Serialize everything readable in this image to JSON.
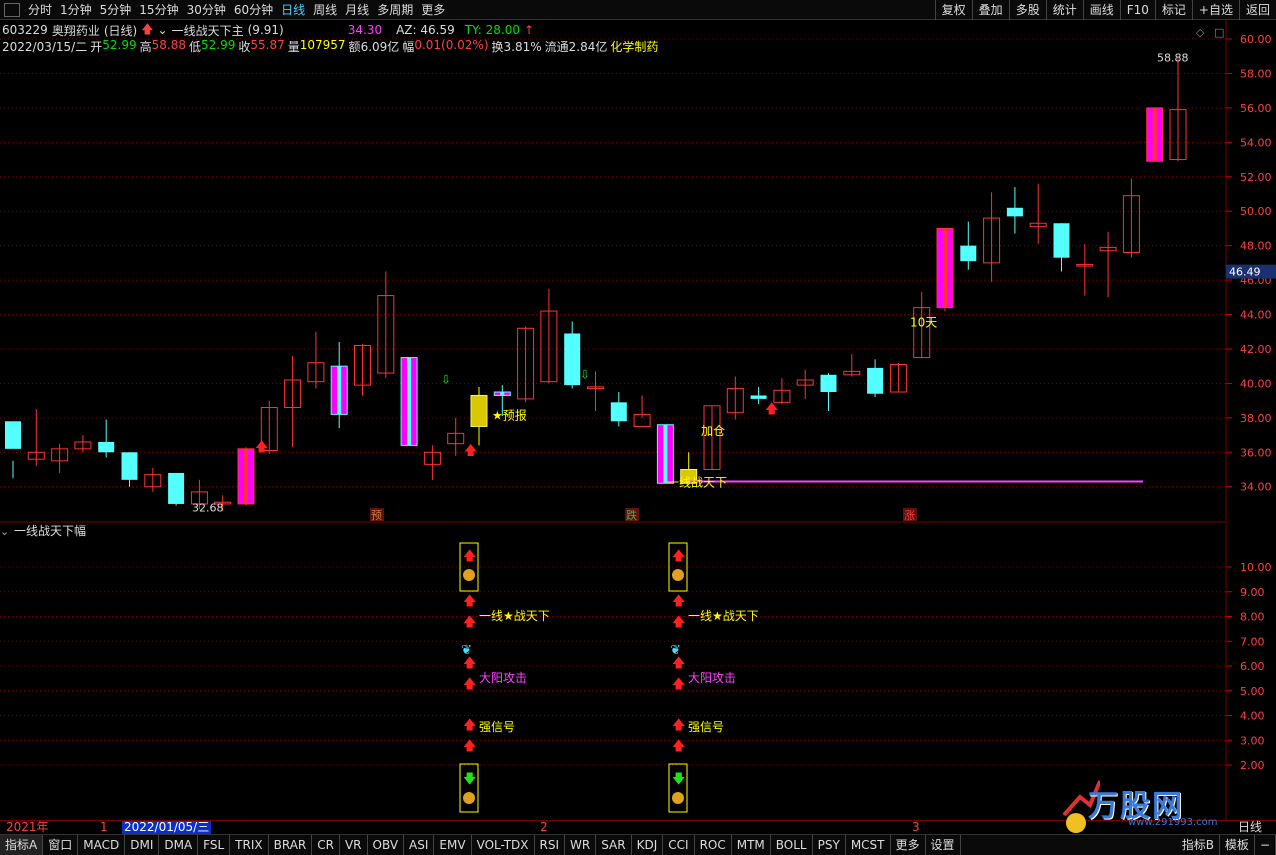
{
  "toolbar": {
    "periods": [
      "分时",
      "1分钟",
      "5分钟",
      "15分钟",
      "30分钟",
      "60分钟",
      "日线",
      "周线",
      "月线",
      "多周期",
      "更多"
    ],
    "active_period": "日线",
    "right_buttons": [
      "复权",
      "叠加",
      "多股",
      "统计",
      "画线",
      "F10",
      "标记",
      "+自选",
      "返回"
    ]
  },
  "info": {
    "code": "603229",
    "name": "奥翔药业",
    "period": "(日线)",
    "indicator": "一线战天下主",
    "indicator_param": "(9.91)",
    "val1": "34.30",
    "az": "AZ: 46.59",
    "ty": "TY: 28.00",
    "date": "2022/03/15/二",
    "open_label": "开",
    "open": "52.99",
    "high_label": "高",
    "high": "58.88",
    "low_label": "低",
    "low": "52.99",
    "close_label": "收",
    "close": "55.87",
    "vol_label": "量",
    "vol": "107957",
    "amt_label": "额",
    "amt": "6.09亿",
    "chg_label": "幅",
    "chg": "0.01(0.02%)",
    "turnover": "换3.81%",
    "float": "流通2.84亿",
    "sector": "化学制药"
  },
  "colors": {
    "up": "#ff3232",
    "down": "#54ffff",
    "special": "#ff00ff",
    "yellow": "#ffff00",
    "grid": "#7a0000"
  },
  "main_axis": {
    "labels": [
      "60.00",
      "58.00",
      "56.00",
      "54.00",
      "52.00",
      "50.00",
      "48.00",
      "46.00",
      "44.00",
      "42.00",
      "40.00",
      "38.00",
      "36.00",
      "34.00"
    ],
    "current": "46.49"
  },
  "chart_data": {
    "type": "candlestick",
    "candles": [
      [
        37.8,
        36.2,
        35.5,
        34.5
      ],
      [
        35.6,
        36.0,
        38.5,
        35.2
      ],
      [
        35.5,
        36.2,
        36.5,
        34.8
      ],
      [
        36.2,
        36.6,
        37.0,
        36.0
      ],
      [
        36.6,
        36.0,
        37.9,
        35.7
      ],
      [
        36.0,
        34.4,
        36.0,
        34.0
      ],
      [
        34.0,
        34.7,
        35.1,
        33.7
      ],
      [
        34.8,
        33.0,
        34.8,
        32.9
      ],
      [
        33.0,
        33.7,
        34.4,
        32.7
      ],
      [
        33.0,
        33.1,
        33.5,
        32.6
      ],
      [
        33.0,
        36.2,
        36.3,
        32.9
      ],
      [
        36.1,
        38.6,
        39.0,
        35.9
      ],
      [
        38.6,
        40.2,
        41.6,
        36.3
      ],
      [
        40.1,
        41.2,
        43.0,
        39.7
      ],
      [
        41.0,
        38.2,
        42.4,
        37.4
      ],
      [
        39.9,
        42.2,
        42.3,
        39.3
      ],
      [
        40.6,
        45.1,
        46.5,
        40.3
      ],
      [
        41.5,
        36.4,
        41.5,
        36.4
      ],
      [
        35.3,
        36.0,
        36.4,
        34.4
      ],
      [
        36.5,
        37.1,
        38.0,
        35.8
      ],
      [
        37.5,
        39.3,
        39.8,
        36.4
      ],
      [
        39.5,
        39.3,
        39.9,
        38.1
      ],
      [
        39.1,
        43.2,
        43.3,
        38.9
      ],
      [
        40.1,
        44.2,
        45.5,
        40.0
      ],
      [
        42.9,
        39.9,
        43.6,
        39.7
      ],
      [
        39.7,
        39.8,
        40.7,
        38.4
      ],
      [
        38.9,
        37.8,
        39.5,
        37.5
      ],
      [
        37.5,
        38.2,
        39.3,
        38.0
      ],
      [
        37.6,
        34.2,
        37.6,
        34.2
      ],
      [
        34.2,
        35.0,
        36.0,
        34.2
      ],
      [
        35.0,
        38.7,
        38.7,
        35.0
      ],
      [
        38.3,
        39.7,
        40.4,
        37.9
      ],
      [
        39.3,
        39.1,
        39.8,
        38.8
      ],
      [
        38.9,
        39.6,
        40.3,
        38.8
      ],
      [
        39.9,
        40.2,
        40.8,
        39.1
      ],
      [
        40.5,
        39.5,
        40.6,
        38.4
      ],
      [
        40.5,
        40.7,
        41.7,
        40.4
      ],
      [
        40.9,
        39.4,
        41.4,
        39.2
      ],
      [
        39.5,
        41.1,
        41.2,
        39.5
      ],
      [
        41.5,
        44.4,
        45.3,
        41.5
      ],
      [
        44.4,
        49.0,
        49.0,
        44.2
      ],
      [
        48.0,
        47.1,
        49.4,
        46.6
      ],
      [
        47.0,
        49.6,
        51.1,
        45.9
      ],
      [
        50.2,
        49.7,
        51.4,
        48.7
      ],
      [
        49.1,
        49.3,
        51.6,
        48.1
      ],
      [
        49.3,
        47.3,
        49.3,
        46.5
      ],
      [
        46.9,
        46.9,
        48.1,
        45.1
      ],
      [
        47.7,
        47.9,
        48.8,
        45.0
      ],
      [
        47.6,
        50.9,
        51.9,
        47.3
      ],
      [
        52.9,
        56.0,
        56.0,
        52.9
      ],
      [
        53.0,
        55.9,
        58.9,
        52.9
      ]
    ],
    "special_candles": [
      10,
      14,
      17,
      21,
      28,
      40,
      49
    ],
    "gold_candles": [
      20,
      29
    ],
    "indicator_axis": [
      "10.00",
      "9.00",
      "8.00",
      "7.00",
      "6.00",
      "5.00",
      "4.00",
      "3.00",
      "2.00"
    ]
  },
  "annotations": {
    "low_mark": "32.68",
    "high_mark": "58.88",
    "yubao": "★预报",
    "jiacang": "加仓",
    "yixian": "一线战天下",
    "shitian": "10天",
    "tag_yu": "预",
    "tag_die": "跌",
    "tag_zhang": "涨"
  },
  "sub_panel": {
    "title": "一线战天下幅",
    "texts": {
      "t1": "一线★战天下",
      "t2": "大阳攻击",
      "t3": "强信号"
    }
  },
  "bottom_axis": {
    "year": "2021年",
    "m1": "1",
    "date": "2022/01/05/三",
    "m2": "2",
    "m3": "3",
    "period": "日线"
  },
  "bottom_tabs": [
    "指标A",
    "窗口",
    "MACD",
    "DMI",
    "DMA",
    "FSL",
    "TRIX",
    "BRAR",
    "CR",
    "VR",
    "OBV",
    "ASI",
    "EMV",
    "VOL-TDX",
    "RSI",
    "WR",
    "SAR",
    "KDJ",
    "CCI",
    "ROC",
    "MTM",
    "BOLL",
    "PSY",
    "MCST",
    "更多",
    "设置"
  ],
  "bottom_right": [
    "指标B",
    "模板",
    "−"
  ],
  "watermark": {
    "name": "万股网",
    "site": "www.291993.com"
  }
}
